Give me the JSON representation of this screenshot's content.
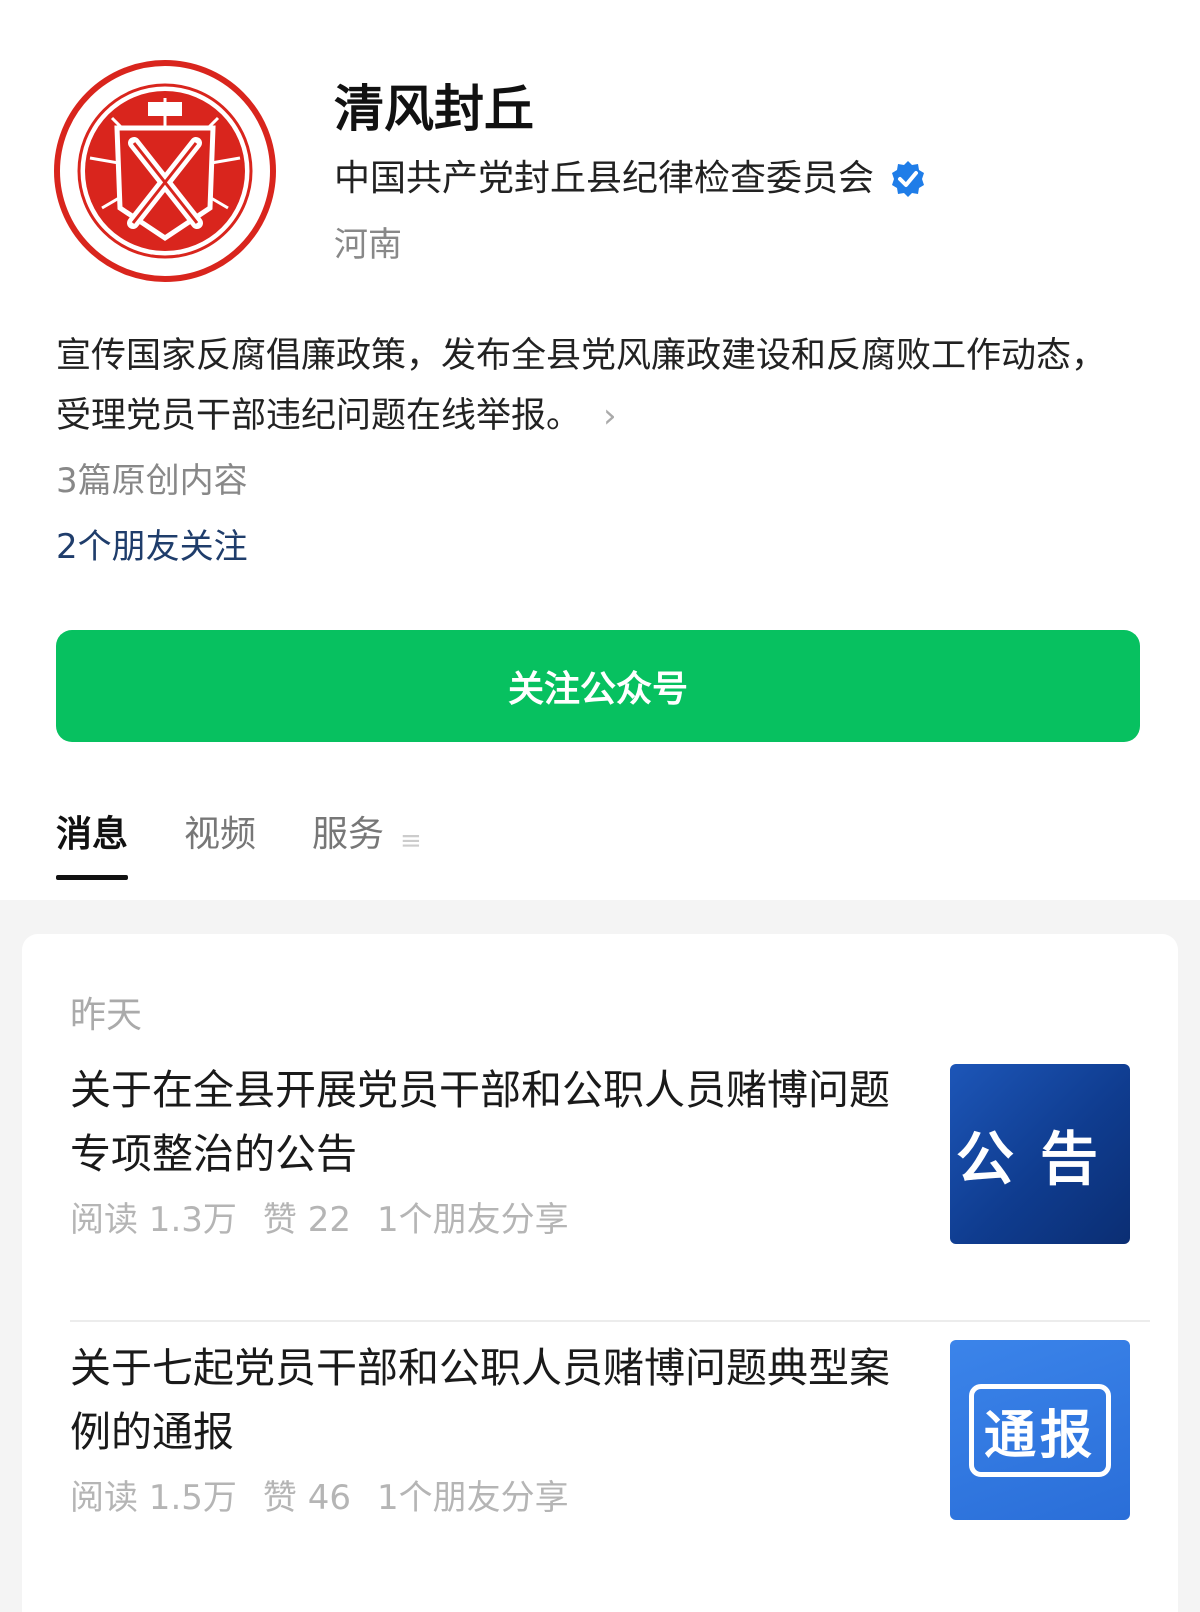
{
  "profile": {
    "account_name": "清风封丘",
    "organization": "中国共产党封丘县纪律检查委员会",
    "region": "河南",
    "verified_color": "#1f7de8",
    "logo_color": "#d9251d"
  },
  "description": {
    "text": "宣传国家反腐倡廉政策，发布全县党风廉政建设和反腐败工作动态，受理党员干部违纪问题在线举报。",
    "more_icon": "chevron-right-icon"
  },
  "stats": {
    "original_content": "3篇原创内容",
    "friends_following": "2个朋友关注"
  },
  "follow_button": {
    "label": "关注公众号",
    "color": "#07c160"
  },
  "tabs": [
    {
      "label": "消息",
      "active": true
    },
    {
      "label": "视频",
      "active": false
    },
    {
      "label": "服务",
      "active": false
    }
  ],
  "feed": {
    "date_label": "昨天",
    "articles": [
      {
        "title": "关于在全县开展党员干部和公职人员赌博问题专项整治的公告",
        "reads": "阅读 1.3万",
        "likes": "赞 22",
        "shares": "1个朋友分享",
        "thumb_text": "公告"
      },
      {
        "title": "关于七起党员干部和公职人员赌博问题典型案例的通报",
        "reads": "阅读 1.5万",
        "likes": "赞 46",
        "shares": "1个朋友分享",
        "thumb_text": "通报"
      }
    ]
  }
}
